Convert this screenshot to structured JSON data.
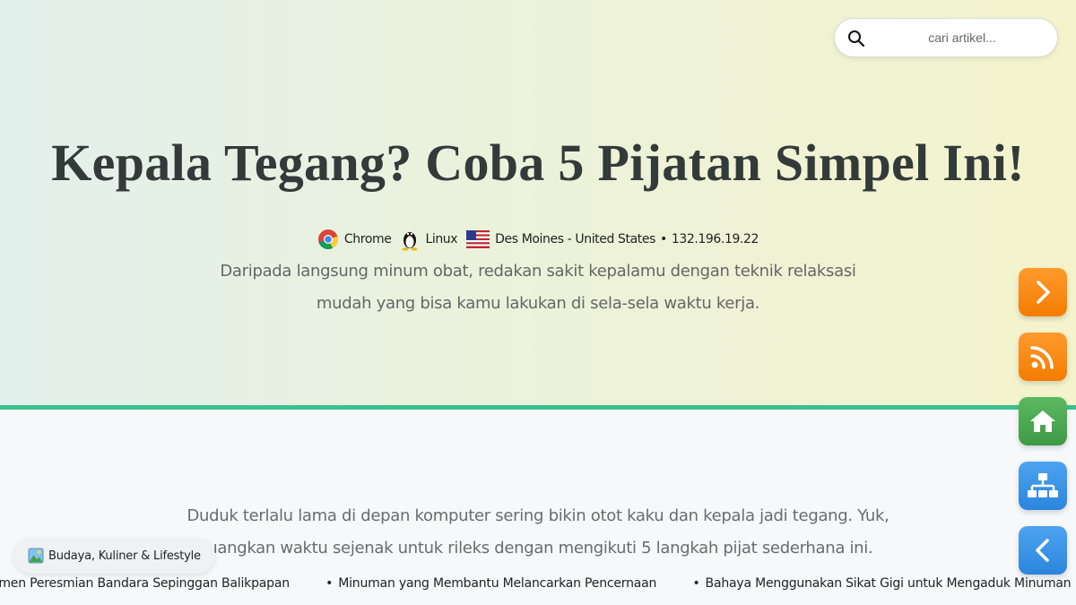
{
  "search": {
    "placeholder": "cari artikel..."
  },
  "article": {
    "title": "Kepala Tegang? Coba 5 Pijatan Simpel Ini!",
    "subtitle": "Daripada langsung minum obat, redakan sakit kepalamu dengan teknik relaksasi mudah yang bisa kamu lakukan di sela-sela waktu kerja.",
    "intro": "Duduk terlalu lama di depan komputer sering bikin otot kaku dan kepala jadi tegang. Yuk, luangkan waktu sejenak untuk rileks dengan mengikuti 5 langkah pijat sederhana ini."
  },
  "visitor": {
    "browser": "Chrome",
    "browser_icon": "chrome-icon",
    "os": "Linux",
    "os_icon": "linux-tux-icon",
    "location": "Des Moines - United States",
    "location_icon": "us-flag-icon",
    "separator": "•",
    "ip": "132.196.19.22"
  },
  "category": {
    "label": "Budaya, Kuliner & Lifestyle",
    "icon": "landscape-picture-icon"
  },
  "ticker": {
    "bullet": "•",
    "items": [
      "omen Peresmian Bandara Sepinggan Balikpapan",
      "Minuman yang Membantu Melancarkan Pencernaan",
      "Bahaya Menggunakan Sikat Gigi untuk Mengaduk Minuman"
    ]
  },
  "floating_buttons": [
    {
      "name": "next",
      "icon": "chevron-right-icon",
      "color": "#f57c00"
    },
    {
      "name": "rss",
      "icon": "rss-icon",
      "color": "#f57c00"
    },
    {
      "name": "home",
      "icon": "home-icon",
      "color": "#3e9a44"
    },
    {
      "name": "sitemap",
      "icon": "sitemap-icon",
      "color": "#2b86dc"
    },
    {
      "name": "back",
      "icon": "chevron-left-icon",
      "color": "#2b86dc"
    }
  ],
  "colors": {
    "accent_border": "#3cc08e",
    "title": "#333a3a",
    "body_text": "#6b6b6b"
  }
}
